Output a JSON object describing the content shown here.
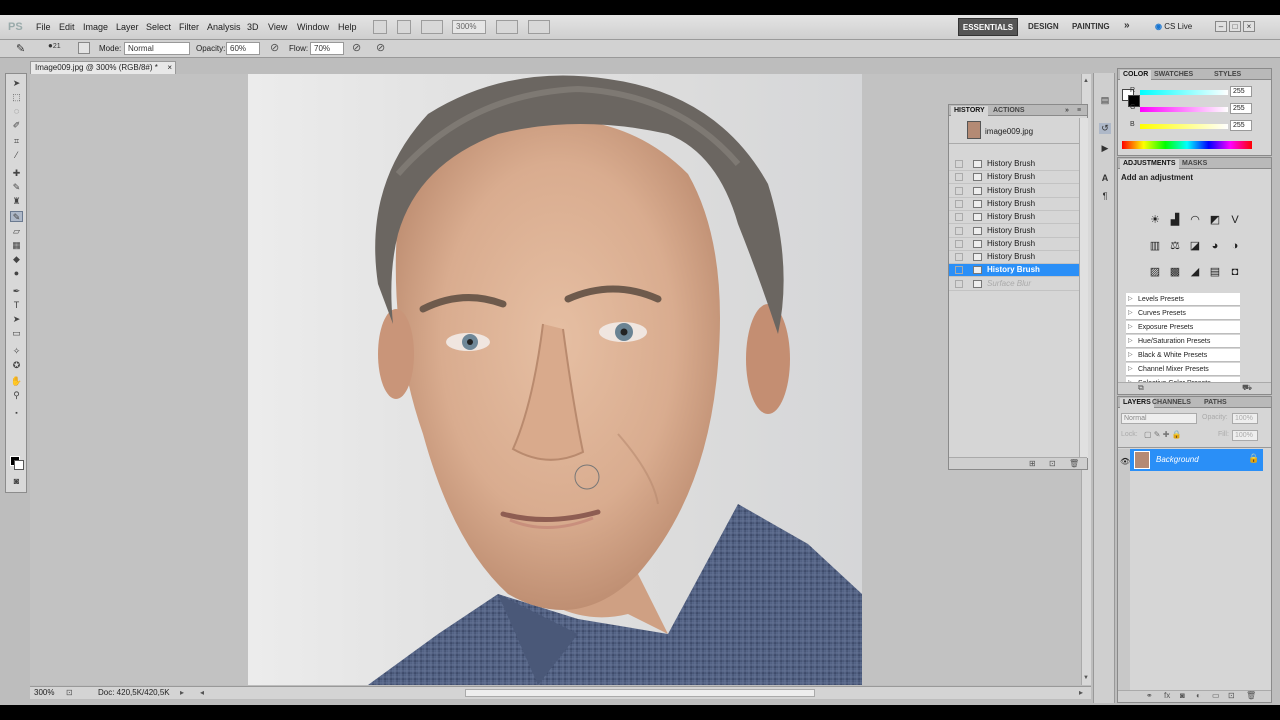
{
  "app": {
    "logo": "PS"
  },
  "menu": [
    "File",
    "Edit",
    "Image",
    "Layer",
    "Select",
    "Filter",
    "Analysis",
    "3D",
    "View",
    "Window",
    "Help"
  ],
  "menubar": {
    "zoom": "300%"
  },
  "workspaces": {
    "active": "ESSENTIALS",
    "others": [
      "DESIGN",
      "PAINTING"
    ],
    "more": "»"
  },
  "cslive": "CS Live",
  "window_controls": [
    "–",
    "□",
    "×"
  ],
  "options": {
    "brush_size": "21",
    "mode_label": "Mode:",
    "mode_value": "Normal",
    "opacity_label": "Opacity:",
    "opacity_value": "60%",
    "flow_label": "Flow:",
    "flow_value": "70%"
  },
  "document": {
    "tab_title": "Image009.jpg @ 300% (RGB/8#) *",
    "tab_close": "×"
  },
  "status": {
    "zoom": "300%",
    "doc": "Doc: 420,5K/420,5K"
  },
  "history": {
    "tabs": [
      "HISTORY",
      "ACTIONS"
    ],
    "snapshot": "image009.jpg",
    "items": [
      "History Brush",
      "History Brush",
      "History Brush",
      "History Brush",
      "History Brush",
      "History Brush",
      "History Brush",
      "History Brush",
      "History Brush",
      "Surface Blur"
    ],
    "active_index": 8
  },
  "color": {
    "tabs": [
      "COLOR",
      "SWATCHES",
      "STYLES"
    ],
    "channels": [
      {
        "label": "R",
        "value": "255"
      },
      {
        "label": "G",
        "value": "255"
      },
      {
        "label": "B",
        "value": "255"
      }
    ]
  },
  "adjustments": {
    "tabs": [
      "ADJUSTMENTS",
      "MASKS"
    ],
    "heading": "Add an adjustment",
    "icons": [
      "brightness-icon",
      "levels-icon",
      "curves-icon",
      "exposure-icon",
      "vibrance-icon",
      "hue-saturation-icon",
      "color-balance-icon",
      "black-white-icon",
      "photo-filter-icon",
      "channel-mixer-icon",
      "invert-icon",
      "posterize-icon",
      "threshold-icon",
      "gradient-map-icon",
      "selective-color-icon"
    ],
    "presets": [
      "Levels Presets",
      "Curves Presets",
      "Exposure Presets",
      "Hue/Saturation Presets",
      "Black & White Presets",
      "Channel Mixer Presets",
      "Selective Color Presets"
    ]
  },
  "layers": {
    "tabs": [
      "LAYERS",
      "CHANNELS",
      "PATHS"
    ],
    "blend_mode": "Normal",
    "opacity_label": "Opacity:",
    "opacity_value": "100%",
    "lock_label": "Lock:",
    "fill_label": "Fill:",
    "fill_value": "100%",
    "items": [
      {
        "name": "Background",
        "selected": true
      }
    ]
  },
  "colors": {
    "selection": "#2a8ff7",
    "accent": "#1d63c7"
  }
}
